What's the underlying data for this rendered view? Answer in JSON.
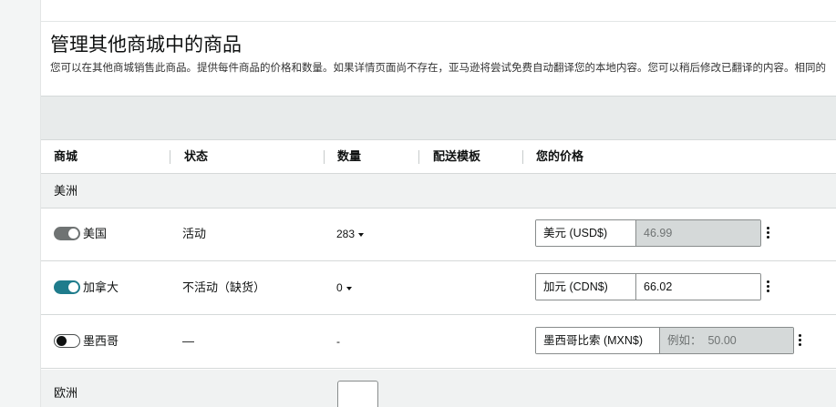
{
  "page": {
    "title": "管理其他商城中的商品",
    "description": "您可以在其他商城销售此商品。提供每件商品的价格和数量。如果详情页面尚不存在，亚马逊将尝试免费自动翻译您的本地内容。您可以稍后修改已翻译的内容。相同的"
  },
  "table": {
    "headers": {
      "marketplace": "商城",
      "status": "状态",
      "quantity": "数量",
      "shipping_template": "配送模板",
      "your_price": "您的价格"
    },
    "regions": [
      {
        "label": "美洲",
        "rows": [
          {
            "market": "美国",
            "toggle": "on-disabled",
            "status": "活动",
            "quantity": "283",
            "currency": "美元 (USD$)",
            "price_value": "46.99",
            "price_placeholder": "",
            "price_disabled": true
          },
          {
            "market": "加拿大",
            "toggle": "on",
            "status": "不活动（缺货）",
            "quantity": "0",
            "currency": "加元 (CDN$)",
            "price_value": "66.02",
            "price_placeholder": "",
            "price_disabled": false
          },
          {
            "market": "墨西哥",
            "toggle": "off",
            "status": "—",
            "quantity": "-",
            "currency": "墨西哥比索 (MXN$)",
            "price_value": "",
            "price_placeholder": "例如：  50.00",
            "price_disabled": true
          }
        ]
      },
      {
        "label": "欧洲",
        "rows": []
      }
    ]
  },
  "colors": {
    "toggle_on": "#1f7c8c",
    "toggle_on_disabled": "#6f7373",
    "band_gray": "#e8ebeb",
    "region_bg": "#f0f2f2",
    "border": "#d5d9d9"
  },
  "icons": {
    "more_actions": "kebab-vertical-icon",
    "dropdown": "caret-down-icon"
  }
}
